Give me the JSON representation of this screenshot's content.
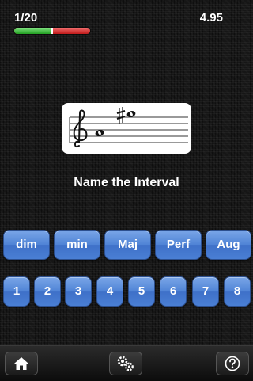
{
  "header": {
    "progress_text": "1/20",
    "timer": "4.95",
    "progress_fraction": 0.49
  },
  "staff": {
    "clef_icon": "treble-clef-icon",
    "notes": [
      "lower-whole-note",
      "upper-sharp-whole-note"
    ]
  },
  "prompt": "Name the Interval",
  "quality_buttons": [
    "dim",
    "min",
    "Maj",
    "Perf",
    "Aug"
  ],
  "number_buttons": [
    "1",
    "2",
    "3",
    "4",
    "5",
    "6",
    "7",
    "8"
  ],
  "toolbar": {
    "home_icon": "home-icon",
    "settings_icon": "gears-icon",
    "help_icon": "help-icon"
  },
  "colors": {
    "button_blue": "#4f83d6",
    "progress_green": "#22a022",
    "progress_red": "#c11b1b"
  }
}
